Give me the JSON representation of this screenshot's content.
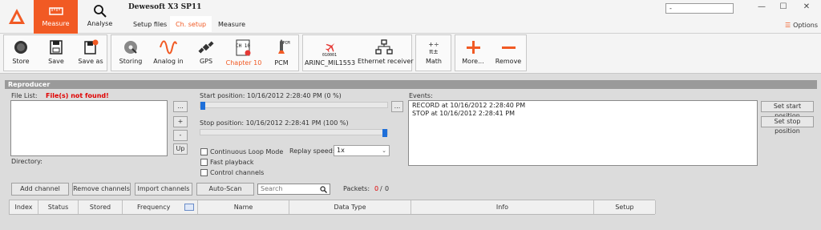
{
  "app": {
    "title": "Dewesoft X3 SP11",
    "title_box_value": "-",
    "options_label": "Options",
    "accent_color": "#f15a24",
    "window_controls": [
      "minimize-icon",
      "maximize-icon",
      "close-icon"
    ]
  },
  "top_modes": [
    {
      "label": "Measure",
      "icon": "measure-icon",
      "active": true
    },
    {
      "label": "Analyse",
      "icon": "magnifier-icon",
      "active": false
    }
  ],
  "sub_tabs": [
    {
      "label": "Setup files",
      "active": false
    },
    {
      "label": "Ch. setup",
      "active": true
    },
    {
      "label": "Measure",
      "active": false
    }
  ],
  "toolbar": {
    "store": "Store",
    "save": "Save",
    "save_as": "Save as",
    "storing": "Storing",
    "analog_in": "Analog in",
    "gps": "GPS",
    "chapter10": "Chapter 10",
    "pcm": "PCM",
    "arinc": "ARINC_MIL1553",
    "ethernet": "Ethernet receiver",
    "math": "Math",
    "more": "More...",
    "remove": "Remove",
    "ch10_icon_text": "CH 10",
    "pcm_icon_text": "PCM",
    "arinc_icon_text": "010001"
  },
  "reproducer": {
    "header": "Reproducer",
    "file_list_label": "File List:",
    "file_error": "File(s) not found!",
    "browse_label": "...",
    "plus_label": "+",
    "minus_label": "-",
    "up_label": "Up",
    "directory_label": "Directory:",
    "start_position": "Start position: 10/16/2012 2:28:40 PM (0 %)",
    "stop_position": "Stop position: 10/16/2012 2:28:41 PM (100 %)",
    "start_percent": 0,
    "stop_percent": 100,
    "continuous_loop": "Continuous Loop Mode",
    "fast_playback": "Fast playback",
    "control_channels": "Control channels",
    "replay_speed_label": "Replay speed:",
    "replay_speed_value": "1x",
    "events_label": "Events:",
    "events": [
      "RECORD at 10/16/2012 2:28:40 PM",
      "STOP at 10/16/2012 2:28:41 PM"
    ],
    "set_start": "Set start position",
    "set_stop": "Set stop position",
    "add_channel": "Add channel",
    "remove_channels": "Remove channels",
    "import_channels": "Import channels",
    "auto_scan": "Auto-Scan",
    "search_placeholder": "Search",
    "packets_label": "Packets:",
    "packets_received": "0",
    "packets_sep": "/",
    "packets_total": "0"
  },
  "table": {
    "columns": [
      "Index",
      "Status",
      "Stored",
      "Frequency",
      "Name",
      "Data Type",
      "Info",
      "Setup"
    ]
  }
}
